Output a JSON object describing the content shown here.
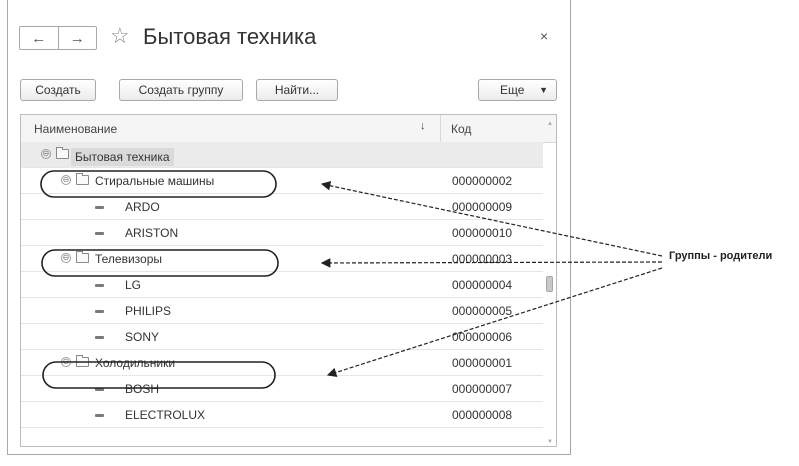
{
  "window": {
    "title": "Бытовая техника",
    "back_icon": "←",
    "forward_icon": "→",
    "star_icon": "☆",
    "close_icon": "×"
  },
  "toolbar": {
    "create_label": "Создать",
    "create_group_label": "Создать группу",
    "find_label": "Найти...",
    "more_label": "Еще",
    "more_caret": "▼"
  },
  "table": {
    "col_name": "Наименование",
    "sort_icon": "↓",
    "col_code": "Код",
    "rows": [
      {
        "type": "group",
        "level": 0,
        "expander": "⊖",
        "name": "Бытовая техника",
        "code": "",
        "selected": true
      },
      {
        "type": "group",
        "level": 1,
        "expander": "⊖",
        "name": "Стиральные машины",
        "code": "000000002"
      },
      {
        "type": "item",
        "level": 2,
        "name": "ARDO",
        "code": "000000009"
      },
      {
        "type": "item",
        "level": 2,
        "name": "ARISTON",
        "code": "000000010"
      },
      {
        "type": "group",
        "level": 1,
        "expander": "⊖",
        "name": "Телевизоры",
        "code": "000000003"
      },
      {
        "type": "item",
        "level": 2,
        "name": "LG",
        "code": "000000004"
      },
      {
        "type": "item",
        "level": 2,
        "name": "PHILIPS",
        "code": "000000005"
      },
      {
        "type": "item",
        "level": 2,
        "name": "SONY",
        "code": "000000006"
      },
      {
        "type": "group",
        "level": 1,
        "expander": "⊖",
        "name": "Холодильники",
        "code": "000000001"
      },
      {
        "type": "item",
        "level": 2,
        "name": "BOSH",
        "code": "000000007"
      },
      {
        "type": "item",
        "level": 2,
        "name": "ELECTROLUX",
        "code": "000000008"
      }
    ]
  },
  "annotation": {
    "label": "Группы - родители"
  }
}
